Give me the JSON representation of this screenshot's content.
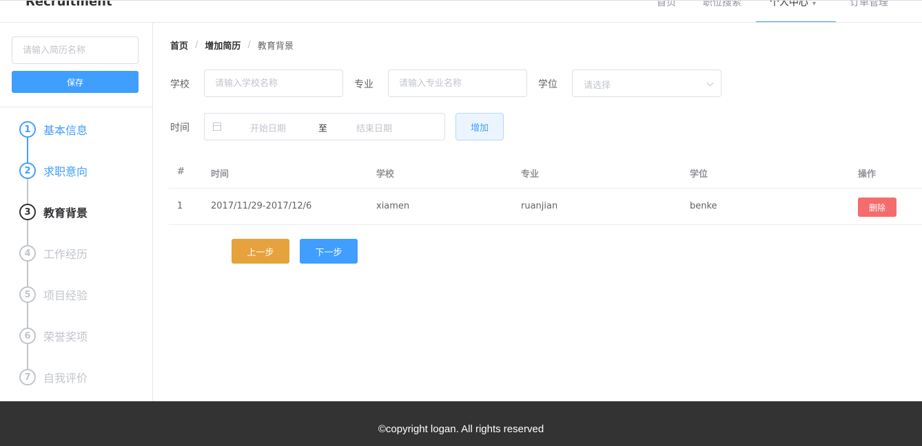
{
  "header": {
    "brand": "Recruitment",
    "nav": [
      {
        "label": "首页"
      },
      {
        "label": "职位搜索"
      },
      {
        "label": "个人中心"
      },
      {
        "label": "订单管理"
      }
    ]
  },
  "sidebar": {
    "resume_name_placeholder": "请输入简历名称",
    "save_label": "保存",
    "steps": [
      {
        "num": "1",
        "label": "基本信息",
        "state": "done"
      },
      {
        "num": "2",
        "label": "求职意向",
        "state": "done"
      },
      {
        "num": "3",
        "label": "教育背景",
        "state": "current"
      },
      {
        "num": "4",
        "label": "工作经历",
        "state": "pending"
      },
      {
        "num": "5",
        "label": "项目经验",
        "state": "pending"
      },
      {
        "num": "6",
        "label": "荣誉奖项",
        "state": "pending"
      },
      {
        "num": "7",
        "label": "自我评价",
        "state": "pending"
      }
    ]
  },
  "breadcrumb": {
    "items": [
      "首页",
      "增加简历",
      "教育背景"
    ],
    "separator": "/"
  },
  "form": {
    "school_label": "学校",
    "school_placeholder": "请输入学校名称",
    "major_label": "专业",
    "major_placeholder": "请输入专业名称",
    "degree_label": "学位",
    "degree_placeholder": "请选择",
    "time_label": "时间",
    "start_placeholder": "开始日期",
    "range_separator": "至",
    "end_placeholder": "结束日期",
    "add_label": "增加"
  },
  "table": {
    "headers": [
      "#",
      "时间",
      "学校",
      "专业",
      "学位",
      "操作"
    ],
    "rows": [
      {
        "index": "1",
        "time": "2017/11/29-2017/12/6",
        "school": "xiamen",
        "major": "ruanjian",
        "degree": "benke",
        "action": "删除"
      }
    ]
  },
  "actions": {
    "prev_label": "上一步",
    "next_label": "下一步"
  },
  "footer": {
    "copyright": "©copyright logan. All rights reserved"
  },
  "colors": {
    "primary": "#409eff",
    "warning": "#e6a23c",
    "danger": "#f56c6c",
    "footer_bg": "#333333"
  }
}
